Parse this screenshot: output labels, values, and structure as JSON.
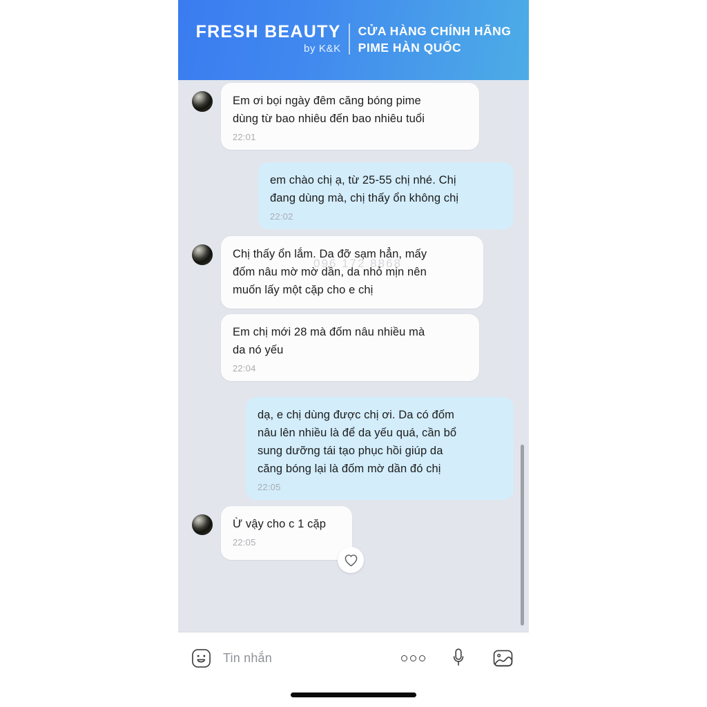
{
  "header": {
    "brand_main": "FRESH BEAUTY",
    "brand_sub": "by K&K",
    "store_line1": "CỬA HÀNG CHÍNH HÃNG",
    "store_line2": "PIME HÀN QUỐC",
    "gradient_from": "#3a7cf0",
    "gradient_to": "#4dace6"
  },
  "chat": {
    "background_color": "#e2e5ec",
    "incoming_bubble_color": "#fcfcfc",
    "outgoing_bubble_color": "#d3edfb",
    "watermark": "096 172 8868",
    "messages": [
      {
        "side": "incoming",
        "text": "Em ơi bọi ngày đêm căng bóng pime\ndùng từ bao nhiêu đến bao nhiêu tuổi",
        "time": "22:01"
      },
      {
        "side": "outgoing",
        "text": "em chào chị ạ, từ 25-55 chị nhé. Chị\nđang dùng mà, chị thấy ổn không chị",
        "time": "22:02"
      },
      {
        "side": "incoming",
        "text": "Chị thấy ổn lắm. Da đỡ sạm hẳn, mấy\nđốm nâu mờ mờ dần, da nhỏ mịn nên\nmuốn lấy một cặp cho e chị",
        "time": ""
      },
      {
        "side": "incoming",
        "text": "Em chị mới 28 mà đốm nâu nhiều mà\nda nó yếu",
        "time": "22:04"
      },
      {
        "side": "outgoing",
        "text": "dạ, e chị dùng được chị ơi. Da có đốm\nnâu lên nhiều là để da yếu quá, cần bổ\nsung dưỡng tái tạo phục hồi giúp da\ncăng bóng lại là đốm mờ dần đó chị",
        "time": "22:05"
      },
      {
        "side": "incoming",
        "text": "Ừ vậy cho c 1 cặp",
        "time": "22:05",
        "reaction": "heart-outline"
      }
    ]
  },
  "input_bar": {
    "emoji_icon": "smiley-sticker-icon",
    "placeholder": "Tin nhắn",
    "more_icon": "three-dots-icon",
    "mic_icon": "microphone-icon",
    "gallery_icon": "image-gallery-icon"
  }
}
